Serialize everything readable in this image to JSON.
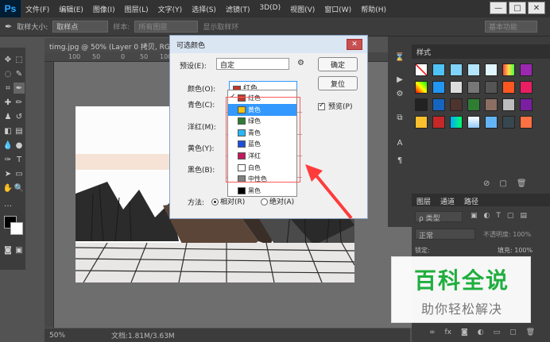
{
  "app": {
    "logo": "Ps",
    "menu": [
      "文件(F)",
      "编辑(E)",
      "图像(I)",
      "图层(L)",
      "文字(Y)",
      "选择(S)",
      "滤镜(T)",
      "3D(D)",
      "视图(V)",
      "窗口(W)",
      "帮助(H)"
    ],
    "window_controls": [
      "—",
      "□",
      "✕"
    ]
  },
  "options_bar": {
    "sample_size_label": "取样大小:",
    "sample_size_value": "取样点",
    "sample_label": "样本:",
    "sample_value": "所有图层",
    "show_ring": "显示取样环",
    "workspace": "基本功能"
  },
  "document": {
    "tab": "timg.jpg @ 50% (Layer 0 拷贝, RGB/8#)",
    "ruler_marks": [
      "100",
      "50",
      "0",
      "50",
      "100"
    ],
    "zoom": "50%",
    "doc_size": "文档:1.81M/3.63M"
  },
  "styles_panel": {
    "tab": "样式"
  },
  "layers_panel": {
    "tabs": [
      "图层",
      "通道",
      "路径"
    ],
    "kind_label": "ρ 类型",
    "blend_mode": "正常",
    "opacity_label": "不透明度: 100%",
    "lock_label": "锁定:",
    "fill_label": "填充: 100%"
  },
  "dialog": {
    "title": "可选颜色",
    "preset_label": "预设(E):",
    "preset_value": "自定",
    "ok_button": "确定",
    "reset_button": "复位",
    "colors_label": "颜色(O):",
    "colors_value": "红色",
    "preview_label": "预览(P)",
    "cyan_label": "青色(C):",
    "magenta_label": "洋红(M):",
    "yellow_label": "黄色(Y):",
    "black_label": "黑色(B):",
    "method_label": "方法:",
    "relative_label": "相对(R)",
    "absolute_label": "绝对(A)"
  },
  "dropdown_items": [
    {
      "label": "红色",
      "color": "#c0392b",
      "checked": true
    },
    {
      "label": "黄色",
      "color": "#f1c40f",
      "highlighted": true
    },
    {
      "label": "绿色",
      "color": "#2e7d32"
    },
    {
      "label": "青色",
      "color": "#29b6f6"
    },
    {
      "label": "蓝色",
      "color": "#1e4fd8"
    },
    {
      "label": "洋红",
      "color": "#c2185b"
    },
    {
      "label": "白色",
      "color": "#ffffff"
    },
    {
      "label": "中性色",
      "color": "#808080"
    },
    {
      "label": "黑色",
      "color": "#000000"
    }
  ],
  "watermark": {
    "title": "百科全说",
    "subtitle": "助你轻松解决"
  }
}
